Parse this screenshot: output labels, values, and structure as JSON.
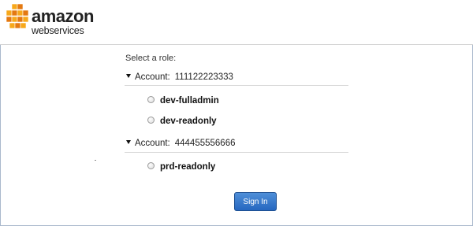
{
  "header": {
    "logo_primary": "amazon",
    "logo_secondary": "webservices",
    "logo_colors": {
      "cubes": "#f7a81b",
      "cube_dark": "#e47911",
      "text": "#222222"
    }
  },
  "form": {
    "prompt": "Select a role:",
    "accounts": [
      {
        "label": "Account:",
        "id": "111122223333",
        "roles": [
          {
            "name": "dev-fulladmin",
            "selected": false
          },
          {
            "name": "dev-readonly",
            "selected": false
          }
        ]
      },
      {
        "label": "Account:",
        "id": "444455556666",
        "roles": [
          {
            "name": "prd-readonly",
            "selected": false
          }
        ]
      }
    ],
    "submit_label": "Sign In"
  },
  "colors": {
    "button_top": "#4f8fd8",
    "button_bottom": "#2667c0",
    "frame_border": "#a9b8cc"
  }
}
